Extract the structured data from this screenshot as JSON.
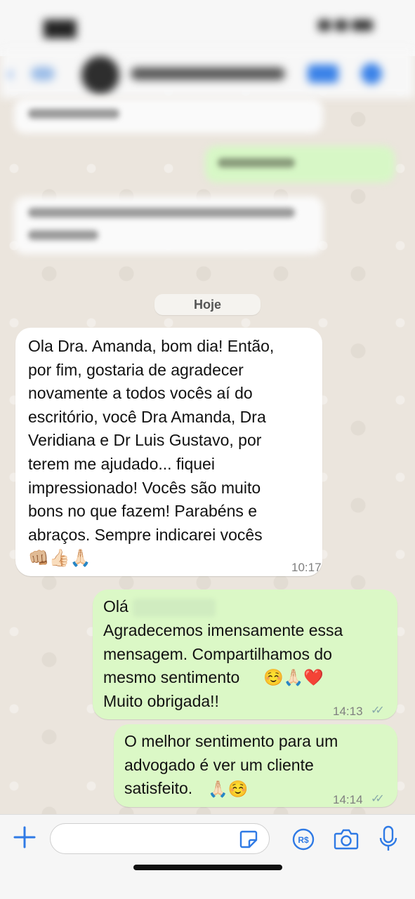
{
  "chat": {
    "date_chip": "Hoje",
    "messages": [
      {
        "direction": "incoming",
        "text": "Ola Dra. Amanda, bom dia! Então,\npor fim, gostaria de agradecer\nnovamente a todos vocês aí do\nescritório, você Dra Amanda, Dra\nVeridiana e Dr Luis Gustavo, por\nterem me ajudado... fiquei\nimpressionado! Vocês são muito\nbons no que fazem! Parabéns e\nabraços. Sempre indicarei vocês",
        "emoji": "👊🏼👍🏻🙏🏻",
        "time": "10:17"
      },
      {
        "direction": "outgoing",
        "greeting": "Olá",
        "text": "Agradecemos imensamente essa\nmensagem. Compartilhamos do\nmesmo sentimento",
        "emoji": "☺️🙏🏻❤️",
        "text2": "Muito obrigada!!",
        "time": "14:13",
        "status": "read"
      },
      {
        "direction": "outgoing",
        "text": "O melhor sentimento para um\nadvogado é ver um cliente\nsatisfeito.",
        "emoji": "🙏🏻☺️",
        "time": "14:14",
        "status": "read"
      }
    ]
  },
  "composer": {
    "placeholder": "",
    "icons": [
      "plus-icon",
      "sticker-icon",
      "payment-icon",
      "camera-icon",
      "microphone-icon"
    ]
  },
  "colors": {
    "incoming_bubble": "#ffffff",
    "outgoing_bubble": "#dbf8c6",
    "accent": "#2f7ae5",
    "wallpaper": "#ebe5dd"
  }
}
